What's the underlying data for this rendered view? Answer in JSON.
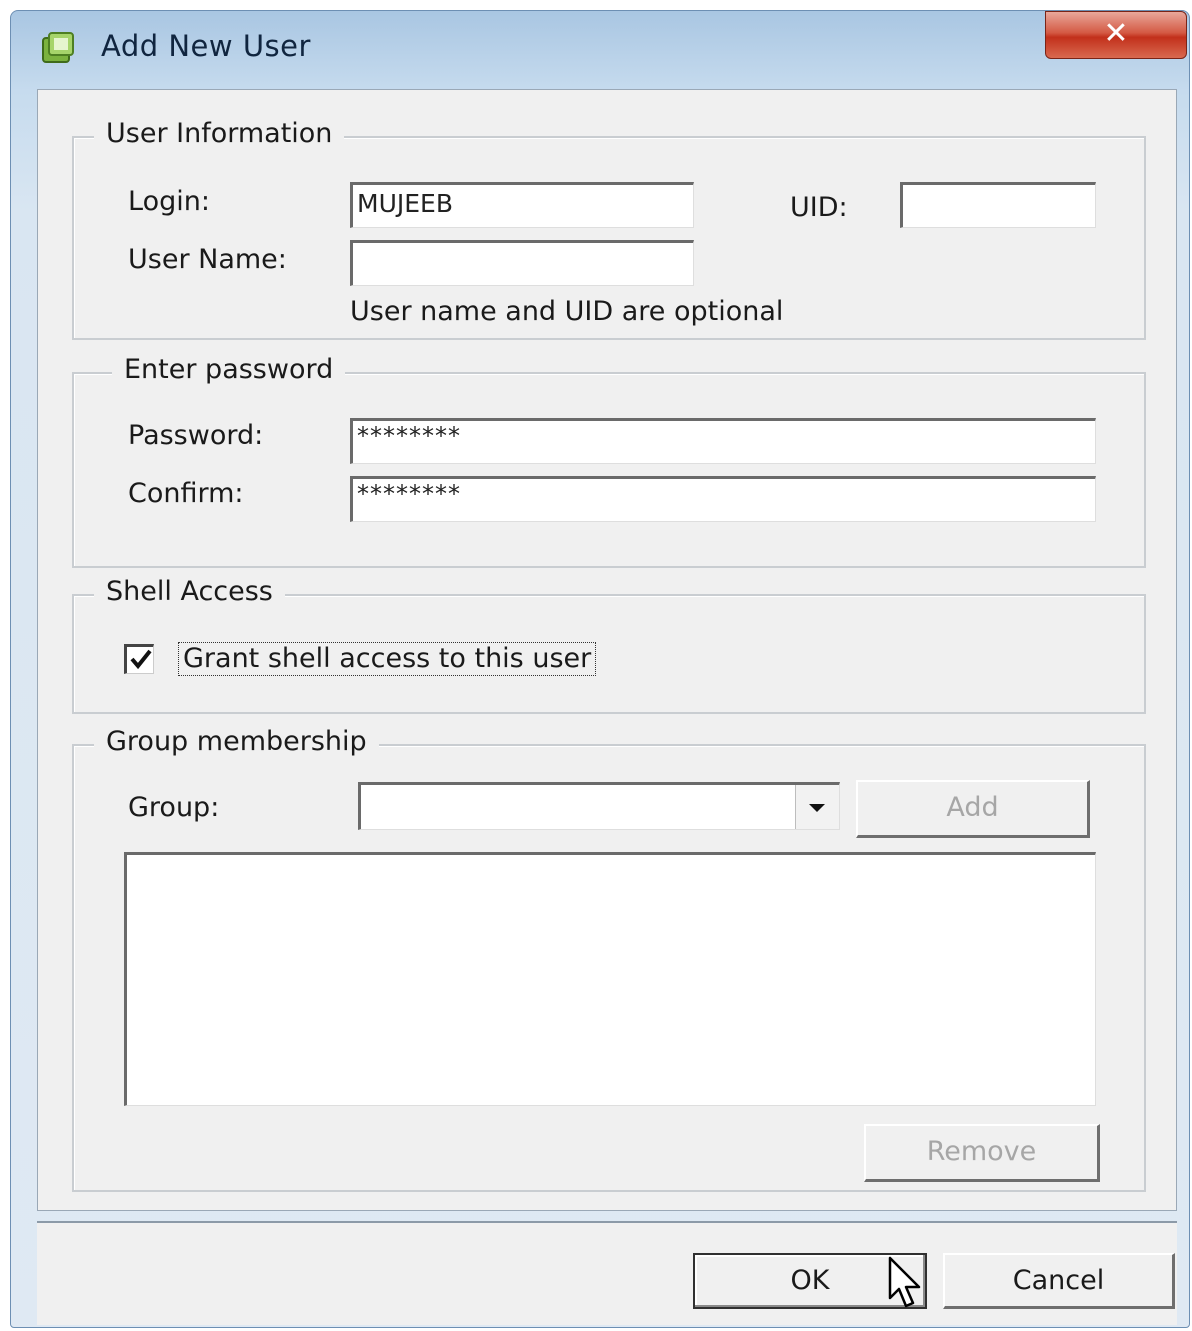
{
  "window": {
    "title": "Add New User",
    "close_glyph": "✕"
  },
  "user_info": {
    "legend": "User Information",
    "login_label": "Login:",
    "login_value": "MUJEEB",
    "uid_label": "UID:",
    "uid_value": "",
    "username_label": "User Name:",
    "username_value": "",
    "hint": "User name and UID are optional"
  },
  "password": {
    "legend": "Enter password",
    "password_label": "Password:",
    "password_value": "********",
    "confirm_label": "Confirm:",
    "confirm_value": "********"
  },
  "shell": {
    "legend": "Shell Access",
    "checkbox_label": "Grant shell access to this user",
    "checked": true
  },
  "groups": {
    "legend": "Group membership",
    "group_label": "Group:",
    "group_value": "",
    "add_label": "Add",
    "remove_label": "Remove",
    "members": []
  },
  "footer": {
    "ok_label": "OK",
    "cancel_label": "Cancel"
  },
  "icons": {
    "app": "users-icon",
    "close": "close-icon",
    "dropdown": "chevron-down-icon",
    "cursor": "mouse-pointer-icon"
  },
  "colors": {
    "close_button": "#c2301b",
    "title_bar": "#a9c6e2",
    "dialog_bg": "#f0f0f0"
  }
}
